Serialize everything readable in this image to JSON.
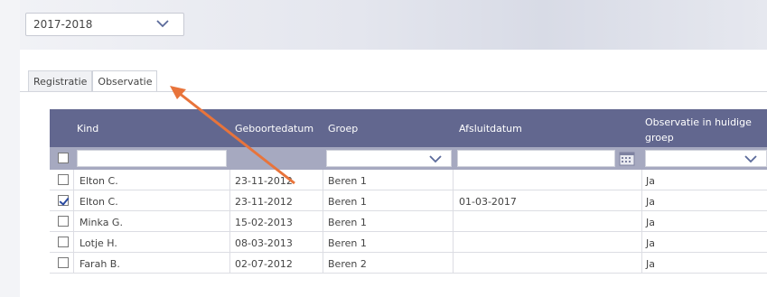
{
  "school_year": {
    "value": "2017-2018"
  },
  "tabs": [
    {
      "label": "Registratie"
    },
    {
      "label": "Observatie"
    }
  ],
  "table": {
    "columns": [
      {
        "label": "Kind"
      },
      {
        "label": "Geboortedatum"
      },
      {
        "label": "Groep"
      },
      {
        "label": "Afsluitdatum"
      },
      {
        "label": "Observatie in huidige groep"
      }
    ],
    "observatie_header_lines": [
      "Observatie in huidige",
      "groep"
    ],
    "rows": [
      {
        "checked": false,
        "kind": "Elton C.",
        "geboortedatum": "23-11-2012",
        "groep": "Beren 1",
        "afsluitdatum": "",
        "observatie": "Ja"
      },
      {
        "checked": true,
        "kind": "Elton C.",
        "geboortedatum": "23-11-2012",
        "groep": "Beren 1",
        "afsluitdatum": "01-03-2017",
        "observatie": "Ja"
      },
      {
        "checked": false,
        "kind": "Minka G.",
        "geboortedatum": "15-02-2013",
        "groep": "Beren 1",
        "afsluitdatum": "",
        "observatie": "Ja"
      },
      {
        "checked": false,
        "kind": "Lotje H.",
        "geboortedatum": "08-03-2013",
        "groep": "Beren 1",
        "afsluitdatum": "",
        "observatie": "Ja"
      },
      {
        "checked": false,
        "kind": "Farah B.",
        "geboortedatum": "02-07-2012",
        "groep": "Beren 2",
        "afsluitdatum": "",
        "observatie": "Ja"
      }
    ]
  },
  "colors": {
    "header_bg": "#62678f",
    "filter_bg": "#a6a9c0",
    "arrow": "#e8743b"
  },
  "annotation": {
    "icon": "arrow-pointer-icon"
  }
}
